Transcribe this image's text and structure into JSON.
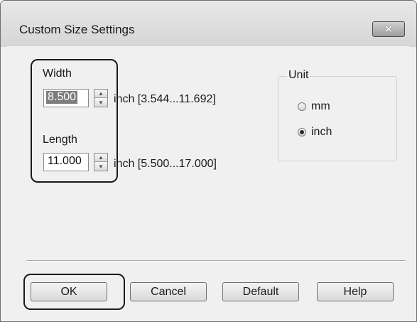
{
  "window": {
    "title": "Custom Size Settings"
  },
  "close_button": {
    "symbol": "✕"
  },
  "width": {
    "label": "Width",
    "value": "8.500",
    "range": "inch [3.544...11.692]"
  },
  "length": {
    "label": "Length",
    "value": "11.000",
    "range": "inch [5.500...17.000]"
  },
  "unit": {
    "title": "Unit",
    "options": [
      {
        "label": "mm",
        "selected": false
      },
      {
        "label": "inch",
        "selected": true
      }
    ]
  },
  "buttons": {
    "ok": "OK",
    "cancel": "Cancel",
    "default": "Default",
    "help": "Help"
  },
  "icons": {
    "spin_up": "▲",
    "spin_down": "▼"
  }
}
